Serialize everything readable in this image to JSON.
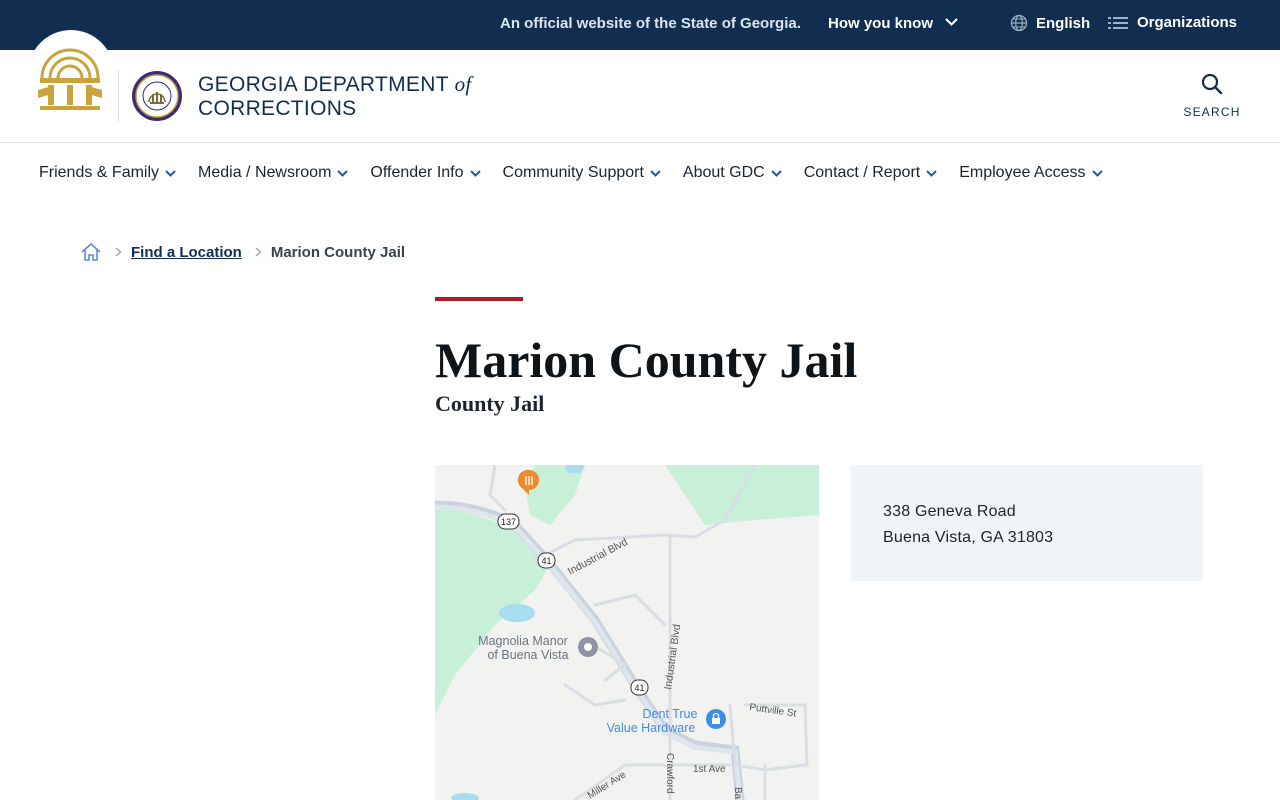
{
  "banner": {
    "official_text": "An official website of the State of Georgia.",
    "how_you_know": "How you know",
    "language": "English",
    "organizations": "Organizations",
    "background_color": "#112e51"
  },
  "header": {
    "agency_line1": "GEORGIA DEPARTMENT",
    "agency_of": "of",
    "agency_line2": "CORRECTIONS",
    "search_label": "SEARCH",
    "seal_text": "DEPARTMENT OF CORRECTIONS"
  },
  "nav": {
    "items": [
      {
        "label": "Friends & Family"
      },
      {
        "label": "Media / Newsroom"
      },
      {
        "label": "Offender Info"
      },
      {
        "label": "Community Support"
      },
      {
        "label": "About GDC"
      },
      {
        "label": "Contact / Report"
      },
      {
        "label": "Employee Access"
      }
    ]
  },
  "breadcrumb": {
    "link": "Find a Location",
    "current": "Marion County Jail"
  },
  "page": {
    "title": "Marion County Jail",
    "subtitle": "County Jail",
    "accent_color": "#b01c24"
  },
  "map": {
    "labels": {
      "route_137": "137",
      "route_41a": "41",
      "route_41b": "41",
      "industrial_blvd_1": "Industrial Blvd",
      "industrial_blvd_2": "Industrial Blvd",
      "magnolia_1": "Magnolia Manor",
      "magnolia_2": "of Buena Vista",
      "dent_1": "Dent True",
      "dent_2": "Value Hardware",
      "puttville": "Puttville St",
      "first_ave": "1st Ave",
      "miller": "Miller Ave",
      "crawford": "Crawford",
      "ba": "Ba"
    }
  },
  "address": {
    "line1": "338 Geneva Road",
    "line2": "Buena Vista, GA 31803"
  }
}
